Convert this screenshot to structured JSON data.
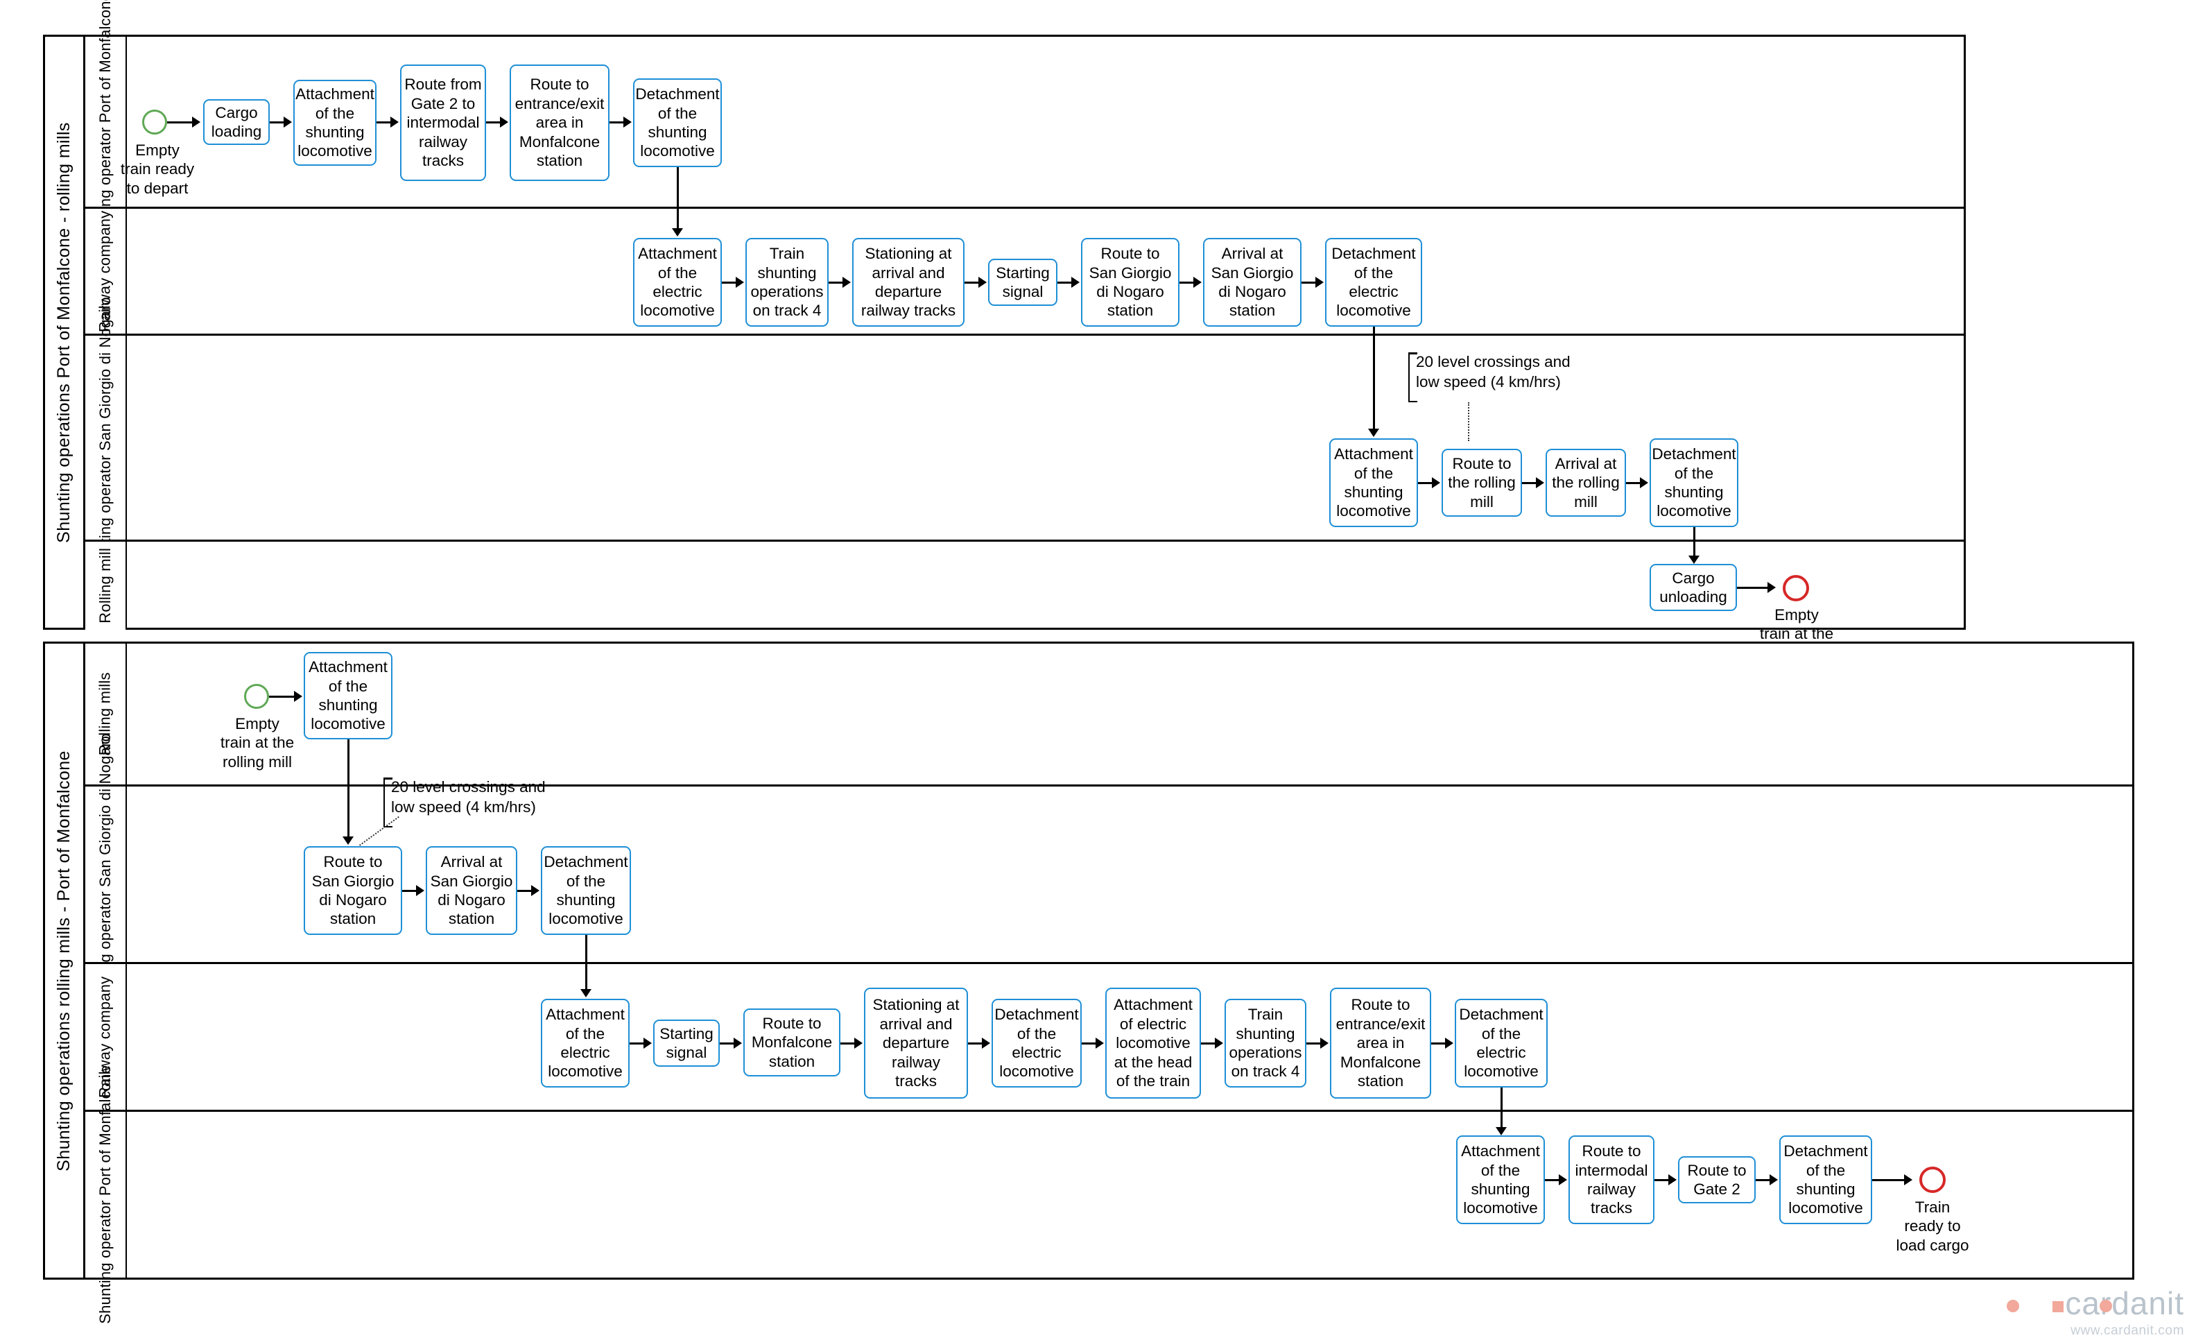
{
  "pools": [
    {
      "title": "Shunting operations Port of Monfalcone - rolling mills",
      "lanes": [
        {
          "label": "Shunting operator\nPort of Monfalcone",
          "tasks": [
            "Cargo\nloading",
            "Attachment\nof the\nshunting\nlocomotive",
            "Route from\nGate 2 to\nintermodal\nrailway\ntracks",
            "Route to\nentrance/exit\narea in\nMonfalcone\nstation",
            "Detachment\nof the\nshunting\nlocomotive"
          ],
          "start_event_label": "Empty\ntrain ready\nto depart"
        },
        {
          "label": "Railway\ncompany",
          "tasks": [
            "Attachment\nof the\nelectric\nlocomotive",
            "Train\nshunting\noperations\non track 4",
            "Stationing at\narrival and\ndeparture\nrailway tracks",
            "Starting\nsignal",
            "Route to\nSan Giorgio\ndi Nogaro\nstation",
            "Arrival at\nSan Giorgio\ndi Nogaro\nstation",
            "Detachment\nof the\nelectric\nlocomotive"
          ]
        },
        {
          "label": "Shunting operator\nSan Giorgio di\nNogaro",
          "tasks": [
            "Attachment\nof the\nshunting\nlocomotive",
            "Route to\nthe rolling\nmill",
            "Arrival at\nthe rolling\nmill",
            "Detachment\nof the\nshunting\nlocomotive"
          ],
          "annotation": "20 level crossings and\nlow speed (4 km/hrs)"
        },
        {
          "label": "Rolling\nmill",
          "tasks": [
            "Cargo\nunloading"
          ],
          "end_event_label": "Empty\ntrain at the\nrolling mill"
        }
      ]
    },
    {
      "title": "Shunting operations rolling mills - Port of Monfalcone",
      "lanes": [
        {
          "label": "Rolling\nmills",
          "tasks": [
            "Attachment\nof the\nshunting\nlocomotive"
          ],
          "start_event_label": "Empty\ntrain at the\nrolling mill"
        },
        {
          "label": "Shunting operator\nSan Giorgio di\nNogaro",
          "tasks": [
            "Route to\nSan Giorgio\ndi Nogaro\nstation",
            "Arrival at\nSan Giorgio\ndi Nogaro\nstation",
            "Detachment\nof the\nshunting\nlocomotive"
          ],
          "annotation": "20 level crossings and\nlow speed (4 km/hrs)"
        },
        {
          "label": "Railway\ncompany",
          "tasks": [
            "Attachment\nof the\nelectric\nlocomotive",
            "Starting\nsignal",
            "Route to\nMonfalcone\nstation",
            "Stationing at\narrival and\ndeparture\nrailway\ntracks",
            "Detachment\nof the\nelectric\nlocomotive",
            "Attachment\nof electric\nlocomotive\nat the head\nof the train",
            "Train\nshunting\noperations\non track 4",
            "Route to\nentrance/exit\narea in\nMonfalcone\nstation",
            "Detachment\nof the\nelectric\nlocomotive"
          ]
        },
        {
          "label": "Shunting\noperator\nPort of\nMonfalcone",
          "tasks": [
            "Attachment\nof the\nshunting\nlocomotive",
            "Route to\nintermodal\nrailway\ntracks",
            "Route to\nGate 2",
            "Detachment\nof the\nshunting\nlocomotive"
          ],
          "end_event_label": "Train\nready to\nload cargo"
        }
      ]
    }
  ],
  "watermark": {
    "brand": "cardanit",
    "url": "www.cardanit.com"
  },
  "colors": {
    "task_border": "#1f8fd6",
    "start_event": "#5fa855",
    "end_event": "#d62828",
    "pool_border": "#000000",
    "connector": "#000000"
  }
}
